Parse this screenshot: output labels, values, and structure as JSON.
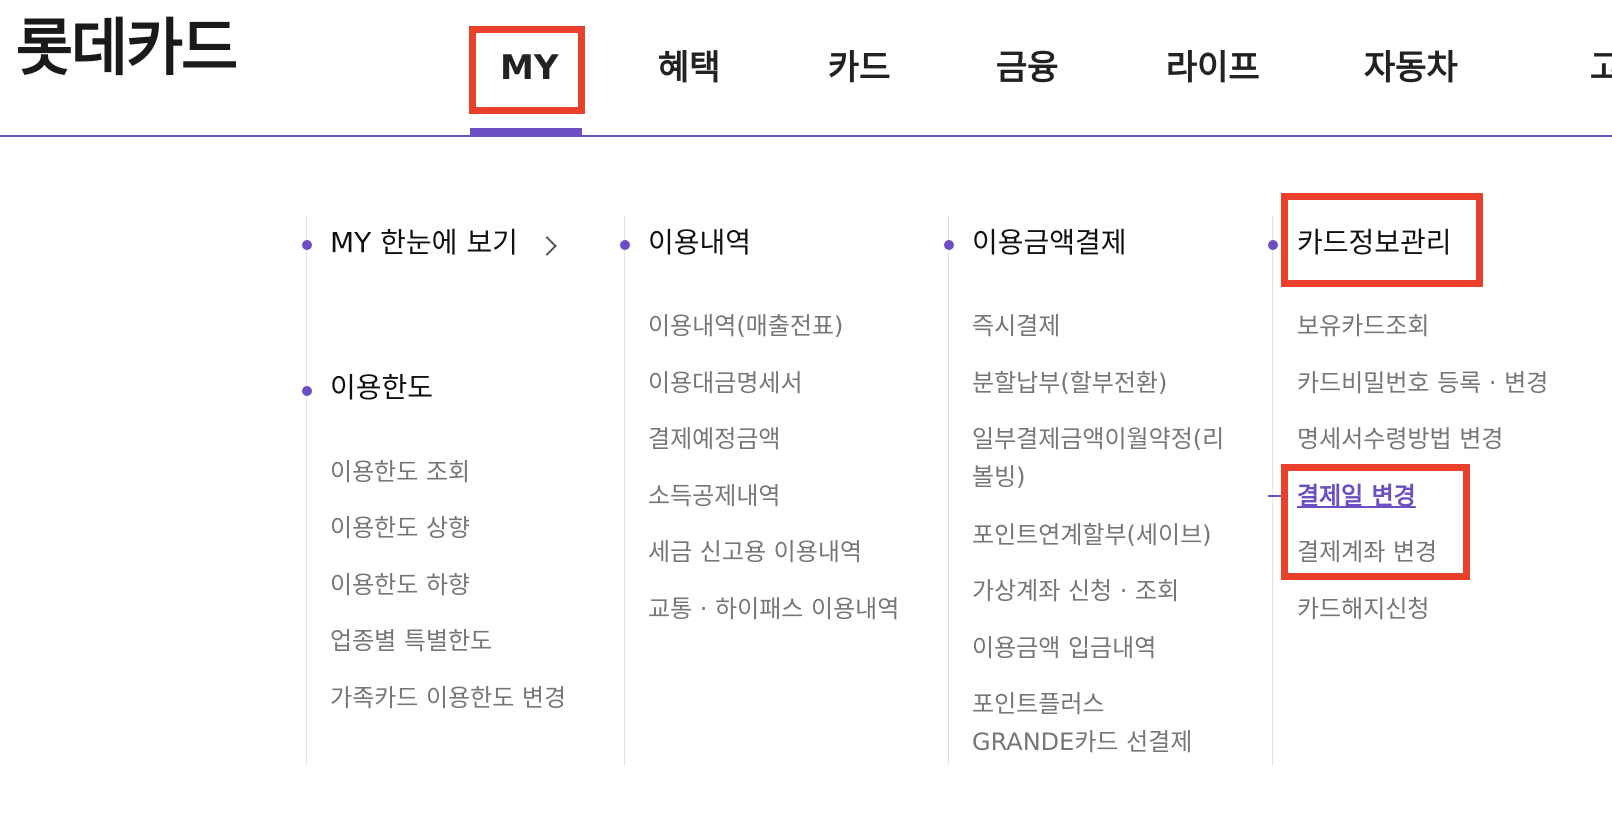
{
  "brand": {
    "logo_text": "롯데카드"
  },
  "gnb": {
    "items": [
      {
        "label": "MY"
      },
      {
        "label": "혜택"
      },
      {
        "label": "카드"
      },
      {
        "label": "금융"
      },
      {
        "label": "라이프"
      },
      {
        "label": "자동차"
      }
    ],
    "overflow_label": "고",
    "active_item": "MY"
  },
  "menu": {
    "my": {
      "overview": {
        "label": "MY 한눈에 보기",
        "icon": "chevron-right-icon"
      },
      "limit": {
        "title": "이용한도",
        "links": [
          "이용한도 조회",
          "이용한도 상향",
          "이용한도 하향",
          "업종별 특별한도",
          "가족카드 이용한도 변경"
        ]
      }
    },
    "usage": {
      "title": "이용내역",
      "links": [
        "이용내역(매출전표)",
        "이용대금명세서",
        "결제예정금액",
        "소득공제내역",
        "세금 신고용 이용내역",
        "교통 · 하이패스 이용내역"
      ]
    },
    "payment": {
      "title": "이용금액결제",
      "links": [
        "즉시결제",
        "분할납부(할부전환)",
        "일부결제금액이월약정(리볼빙)",
        "포인트연계할부(세이브)",
        "가상계좌 신청 · 조회",
        "이용금액 입금내역",
        "포인트플러스 GRANDE카드 선결제"
      ]
    },
    "card_info": {
      "title": "카드정보관리",
      "links": [
        "보유카드조회",
        "카드비밀번호 등록 · 변경",
        "명세서수령방법 변경",
        "결제일 변경",
        "결제계좌 변경",
        "카드해지신청"
      ],
      "active_link": "결제일 변경"
    }
  },
  "colors": {
    "accent": "#6c4fc2",
    "highlight": "#e8402a",
    "link_gray": "#777777"
  }
}
